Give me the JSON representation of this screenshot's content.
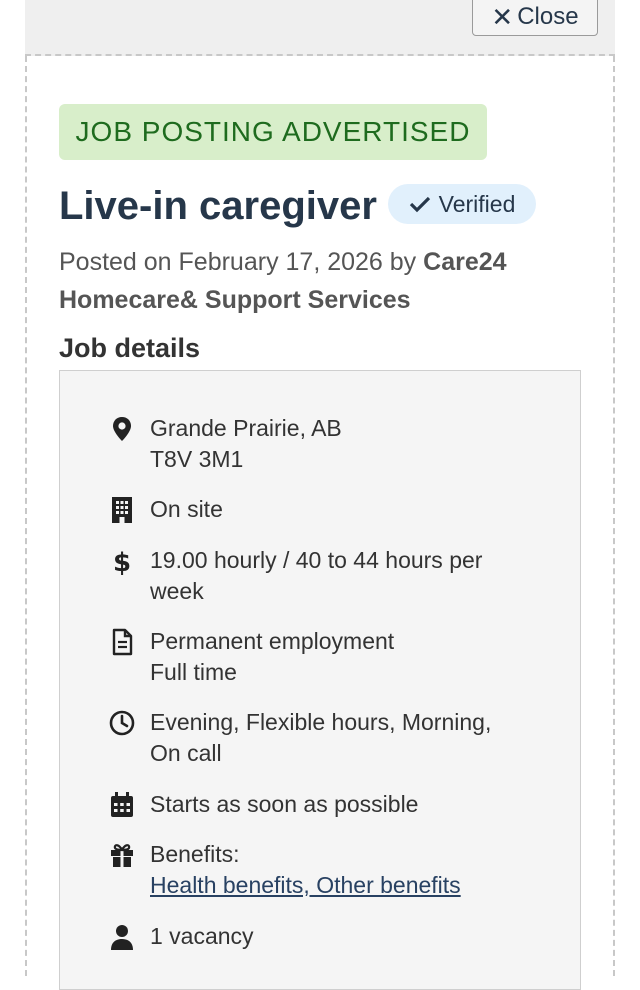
{
  "header": {
    "close_label": "Close"
  },
  "posting": {
    "status_badge": "JOB POSTING ADVERTISED",
    "title": "Live-in caregiver",
    "verified_label": "Verified",
    "posted_prefix": "Posted on February 17, 2026 by",
    "employer": "Care24 Homecare& Support Services"
  },
  "details": {
    "heading": "Job details",
    "location_line1": "Grande Prairie, AB",
    "location_line2": "T8V 3M1",
    "workplace": "On site",
    "salary": "19.00 hourly / 40 to 44 hours per week",
    "employment_type": "Permanent employment",
    "employment_hours": "Full time",
    "schedule": "Evening, Flexible hours, Morning, On call",
    "start": "Starts as soon as possible",
    "benefits_label": "Benefits:",
    "benefits_link": "Health benefits, Other benefits",
    "vacancies": "1 vacancy"
  },
  "icons": {
    "location": "map-marker-icon",
    "workplace": "building-icon",
    "salary": "dollar-icon",
    "employment": "document-icon",
    "schedule": "clock-icon",
    "start": "calendar-icon",
    "benefits": "gift-icon",
    "vacancy": "user-icon",
    "verified": "checkmark-icon",
    "close": "close-icon"
  },
  "colors": {
    "title": "#26374a",
    "badge_bg": "#d8eeca",
    "badge_text": "#1e6b1e",
    "verified_bg": "#e1f0fc",
    "link": "#284162"
  }
}
